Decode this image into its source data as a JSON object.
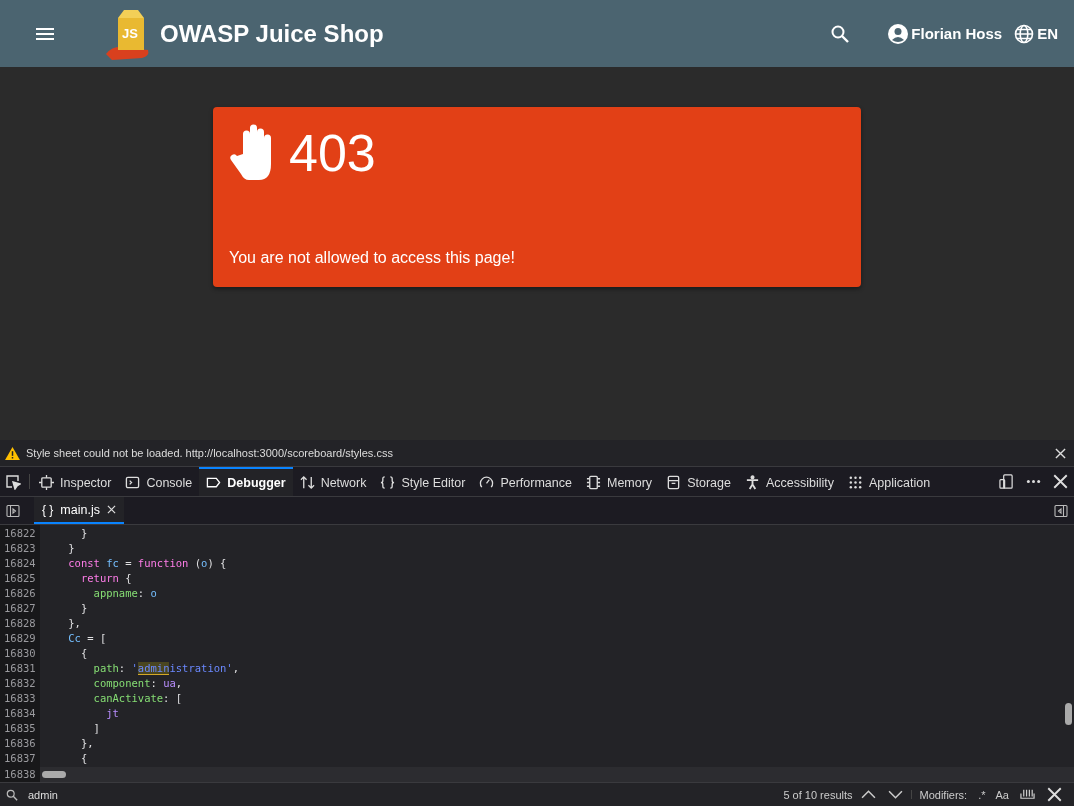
{
  "header": {
    "title": "OWASP Juice Shop",
    "user": "Florian Hoss",
    "language": "EN",
    "logo_text": "JS"
  },
  "error_card": {
    "code": "403",
    "message": "You are not allowed to access this page!"
  },
  "devtools": {
    "notification": {
      "message": "Style sheet could not be loaded. http://localhost:3000/scoreboard/styles.css"
    },
    "tabs": [
      {
        "label": "Inspector",
        "selected": false
      },
      {
        "label": "Console",
        "selected": false
      },
      {
        "label": "Debugger",
        "selected": true
      },
      {
        "label": "Network",
        "selected": false
      },
      {
        "label": "Style Editor",
        "selected": false
      },
      {
        "label": "Performance",
        "selected": false
      },
      {
        "label": "Memory",
        "selected": false
      },
      {
        "label": "Storage",
        "selected": false
      },
      {
        "label": "Accessibility",
        "selected": false
      },
      {
        "label": "Application",
        "selected": false
      }
    ],
    "source_tab": {
      "label": "main.js",
      "brace": "{ }"
    },
    "code_lines": [
      {
        "number": "16822",
        "tokens": [
          {
            "text": "      }",
            "kind": "punct"
          }
        ]
      },
      {
        "number": "16823",
        "tokens": [
          {
            "text": "    }",
            "kind": "punct"
          }
        ]
      },
      {
        "number": "16824",
        "tokens": [
          {
            "text": "    const",
            "kind": "keyword"
          },
          {
            "text": " fc",
            "kind": "ident"
          },
          {
            "text": " = ",
            "kind": "punct"
          },
          {
            "text": "function",
            "kind": "keyword"
          },
          {
            "text": " (",
            "kind": "punct"
          },
          {
            "text": "o",
            "kind": "ident"
          },
          {
            "text": ") {",
            "kind": "punct"
          }
        ]
      },
      {
        "number": "16825",
        "tokens": [
          {
            "text": "      return",
            "kind": "keyword"
          },
          {
            "text": " {",
            "kind": "punct"
          }
        ]
      },
      {
        "number": "16826",
        "tokens": [
          {
            "text": "        appname",
            "kind": "prop"
          },
          {
            "text": ": ",
            "kind": "punct"
          },
          {
            "text": "o",
            "kind": "ident"
          }
        ]
      },
      {
        "number": "16827",
        "tokens": [
          {
            "text": "      }",
            "kind": "punct"
          }
        ]
      },
      {
        "number": "16828",
        "tokens": [
          {
            "text": "    },",
            "kind": "punct"
          }
        ]
      },
      {
        "number": "16829",
        "tokens": [
          {
            "text": "    Cc",
            "kind": "ident"
          },
          {
            "text": " = [",
            "kind": "punct"
          }
        ]
      },
      {
        "number": "16830",
        "tokens": [
          {
            "text": "      {",
            "kind": "punct"
          }
        ]
      },
      {
        "number": "16831",
        "tokens": [
          {
            "text": "        path",
            "kind": "prop"
          },
          {
            "text": ": ",
            "kind": "punct"
          },
          {
            "text": "'",
            "kind": "string"
          },
          {
            "text": "admin",
            "kind": "match"
          },
          {
            "text": "istration'",
            "kind": "string"
          },
          {
            "text": ",",
            "kind": "punct"
          }
        ]
      },
      {
        "number": "16832",
        "tokens": [
          {
            "text": "        component",
            "kind": "prop"
          },
          {
            "text": ": ",
            "kind": "punct"
          },
          {
            "text": "ua",
            "kind": "var"
          },
          {
            "text": ",",
            "kind": "punct"
          }
        ]
      },
      {
        "number": "16833",
        "tokens": [
          {
            "text": "        canActivate",
            "kind": "prop"
          },
          {
            "text": ": [",
            "kind": "punct"
          }
        ]
      },
      {
        "number": "16834",
        "tokens": [
          {
            "text": "          jt",
            "kind": "var"
          }
        ]
      },
      {
        "number": "16835",
        "tokens": [
          {
            "text": "        ]",
            "kind": "punct"
          }
        ]
      },
      {
        "number": "16836",
        "tokens": [
          {
            "text": "      },",
            "kind": "punct"
          }
        ]
      },
      {
        "number": "16837",
        "tokens": [
          {
            "text": "      {",
            "kind": "punct"
          }
        ]
      }
    ],
    "last_line_number": "16838",
    "search": {
      "value": "admin",
      "results": "5 of 10 results",
      "modifiers_label": "Modifiers:",
      "regex_toggle": ".*",
      "case_toggle": "Aa"
    }
  }
}
